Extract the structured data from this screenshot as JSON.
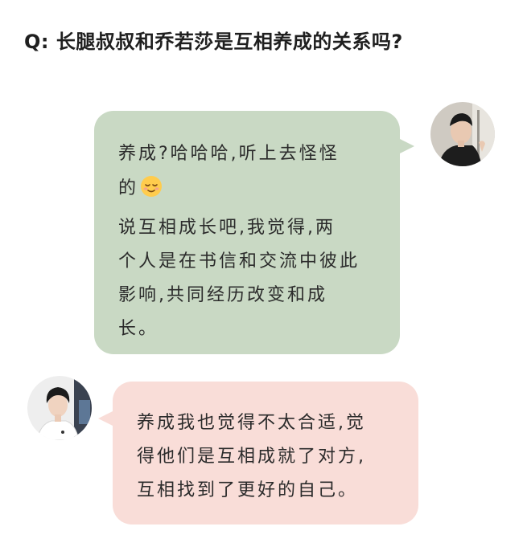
{
  "question": "Q: 长腿叔叔和乔若莎是互相养成的关系吗?",
  "messages": [
    {
      "side": "right",
      "avatar": "male-portrait-avatar",
      "bubble_color": "#c9d9c4",
      "lines": [
        "养成?哈哈哈,听上去怪怪",
        "的",
        "说互相成长吧,我觉得,两",
        "个人是在书信和交流中彼此",
        "影响,共同经历改变和成",
        "长。"
      ],
      "emoji": "relieved-face-emoji"
    },
    {
      "side": "left",
      "avatar": "female-portrait-avatar",
      "bubble_color": "#f9ddd8",
      "lines": [
        "养成我也觉得不太合适,觉",
        "得他们是互相成就了对方,",
        "互相找到了更好的自己。"
      ]
    }
  ]
}
